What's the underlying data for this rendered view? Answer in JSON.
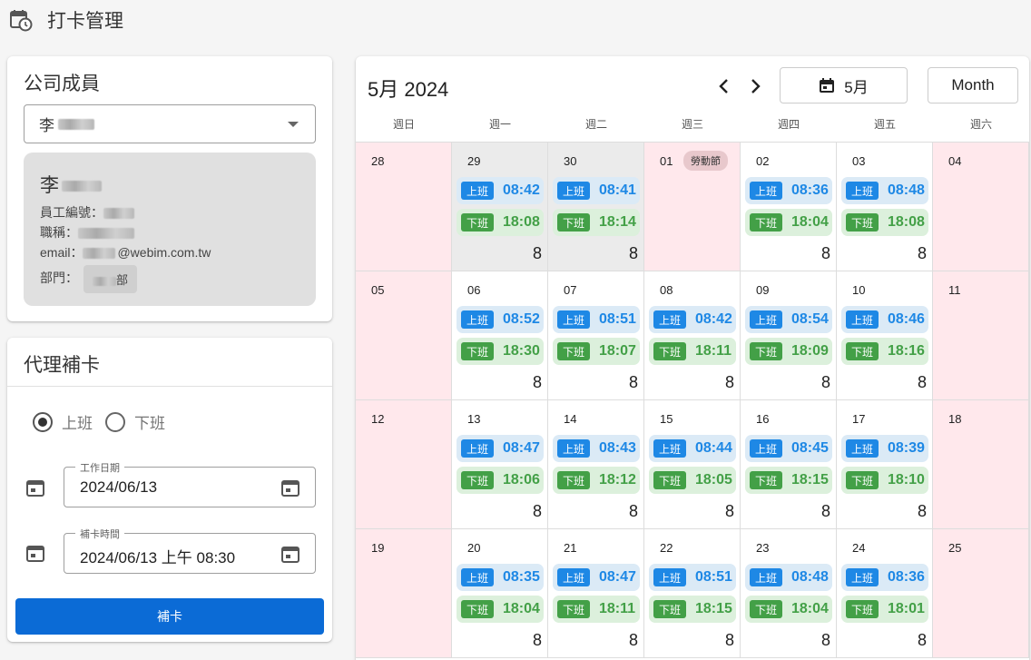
{
  "header": {
    "title": "打卡管理"
  },
  "member": {
    "title": "公司成員",
    "selected": "李",
    "name": "李",
    "employee_id_label": "員工編號：",
    "job_title_label": "職稱：",
    "email_label": "email：",
    "email_domain": "@webim.com.tw",
    "department_label": "部門：",
    "department": "部"
  },
  "proxy": {
    "title": "代理補卡",
    "radio_in": "上班",
    "radio_out": "下班",
    "work_date_label": "工作日期",
    "work_date_value": "2024/06/13",
    "punch_time_label": "補卡時間",
    "punch_time_value": "2024/06/13 上午 08:30",
    "submit_label": "補卡"
  },
  "calendar": {
    "title": "5月 2024",
    "month_button": "5月",
    "view_button": "Month",
    "weekdays": [
      "週日",
      "週一",
      "週二",
      "週三",
      "週四",
      "週五",
      "週六"
    ],
    "in_label": "上班",
    "out_label": "下班",
    "days": [
      {
        "num": "28",
        "kind": "weekend"
      },
      {
        "num": "29",
        "kind": "other",
        "in": "08:42",
        "out": "18:08",
        "hours": "8"
      },
      {
        "num": "30",
        "kind": "other",
        "in": "08:41",
        "out": "18:14",
        "hours": "8"
      },
      {
        "num": "01",
        "kind": "holiday",
        "badge": "勞動節"
      },
      {
        "num": "02",
        "kind": "work",
        "in": "08:36",
        "out": "18:04",
        "hours": "8"
      },
      {
        "num": "03",
        "kind": "work",
        "in": "08:48",
        "out": "18:08",
        "hours": "8"
      },
      {
        "num": "04",
        "kind": "weekend"
      },
      {
        "num": "05",
        "kind": "weekend"
      },
      {
        "num": "06",
        "kind": "work",
        "in": "08:52",
        "out": "18:30",
        "hours": "8"
      },
      {
        "num": "07",
        "kind": "work",
        "in": "08:51",
        "out": "18:07",
        "hours": "8"
      },
      {
        "num": "08",
        "kind": "work",
        "in": "08:42",
        "out": "18:11",
        "hours": "8"
      },
      {
        "num": "09",
        "kind": "work",
        "in": "08:54",
        "out": "18:09",
        "hours": "8"
      },
      {
        "num": "10",
        "kind": "work",
        "in": "08:46",
        "out": "18:16",
        "hours": "8"
      },
      {
        "num": "11",
        "kind": "weekend"
      },
      {
        "num": "12",
        "kind": "weekend"
      },
      {
        "num": "13",
        "kind": "work",
        "in": "08:47",
        "out": "18:06",
        "hours": "8"
      },
      {
        "num": "14",
        "kind": "work",
        "in": "08:43",
        "out": "18:12",
        "hours": "8"
      },
      {
        "num": "15",
        "kind": "work",
        "in": "08:44",
        "out": "18:05",
        "hours": "8"
      },
      {
        "num": "16",
        "kind": "work",
        "in": "08:45",
        "out": "18:15",
        "hours": "8"
      },
      {
        "num": "17",
        "kind": "work",
        "in": "08:39",
        "out": "18:10",
        "hours": "8"
      },
      {
        "num": "18",
        "kind": "weekend"
      },
      {
        "num": "19",
        "kind": "weekend"
      },
      {
        "num": "20",
        "kind": "work",
        "in": "08:35",
        "out": "18:04",
        "hours": "8"
      },
      {
        "num": "21",
        "kind": "work",
        "in": "08:47",
        "out": "18:11",
        "hours": "8"
      },
      {
        "num": "22",
        "kind": "work",
        "in": "08:51",
        "out": "18:15",
        "hours": "8"
      },
      {
        "num": "23",
        "kind": "work",
        "in": "08:48",
        "out": "18:04",
        "hours": "8"
      },
      {
        "num": "24",
        "kind": "work",
        "in": "08:36",
        "out": "18:01",
        "hours": "8"
      },
      {
        "num": "25",
        "kind": "weekend"
      }
    ]
  }
}
